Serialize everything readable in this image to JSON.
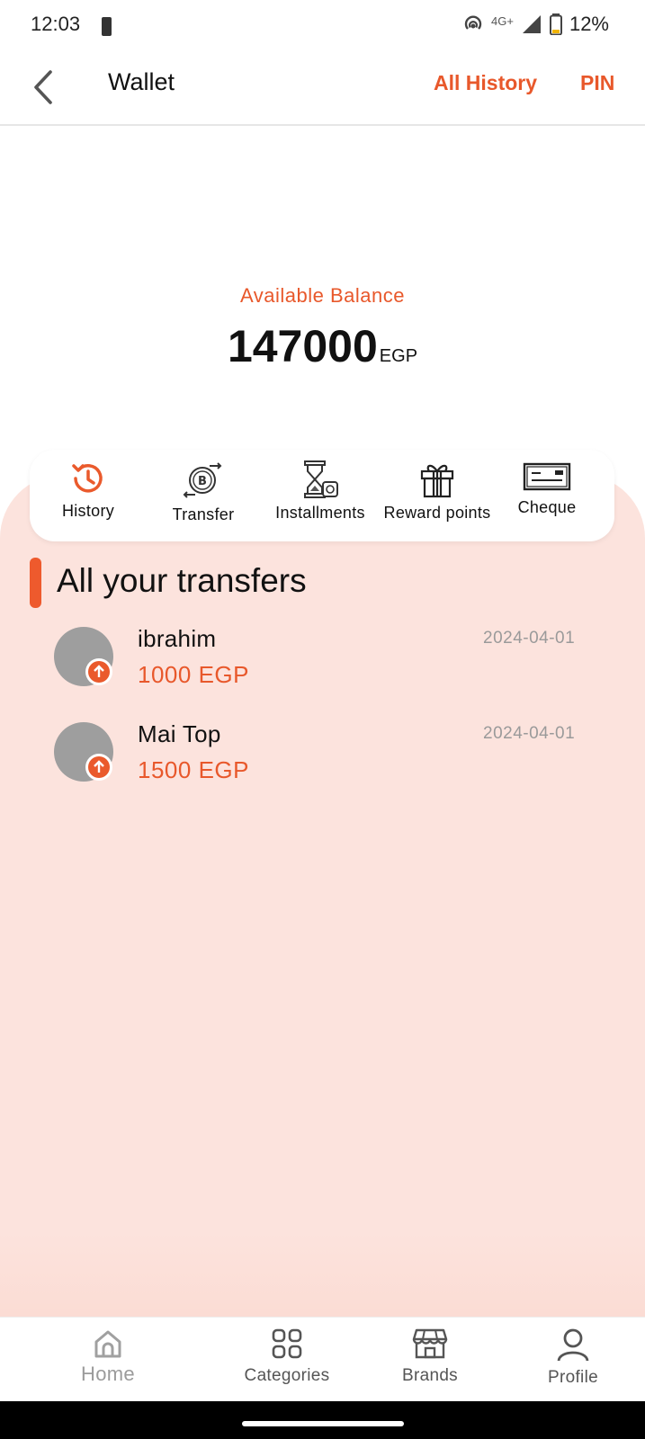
{
  "status_bar": {
    "time": "12:03",
    "network": "4G+",
    "battery": "12%"
  },
  "app_bar": {
    "title": "Wallet",
    "all_history": "All History",
    "pin": "PIN"
  },
  "balance": {
    "label": "Available Balance",
    "amount": "147000",
    "currency": "EGP"
  },
  "actions": [
    {
      "label": "History",
      "icon": "history-icon"
    },
    {
      "label": "Transfer",
      "icon": "bitcoin-transfer-icon"
    },
    {
      "label": "Installments",
      "icon": "hourglass-money-icon"
    },
    {
      "label": "Reward points",
      "icon": "gift-icon"
    },
    {
      "label": "Cheque",
      "icon": "cheque-icon"
    }
  ],
  "section": {
    "title": "All your transfers"
  },
  "transfers": [
    {
      "name": "ibrahim",
      "amount": "1000 EGP",
      "date": "2024-04-01"
    },
    {
      "name": "Mai Top",
      "amount": "1500 EGP",
      "date": "2024-04-01"
    }
  ],
  "bottom_nav": [
    {
      "label": "Home",
      "icon": "home-icon"
    },
    {
      "label": "Categories",
      "icon": "categories-icon"
    },
    {
      "label": "Brands",
      "icon": "store-icon"
    },
    {
      "label": "Profile",
      "icon": "profile-icon"
    }
  ],
  "colors": {
    "accent": "#E8582B",
    "pink_bg": "#FCE3DD",
    "avatar": "#9E9E9E"
  }
}
